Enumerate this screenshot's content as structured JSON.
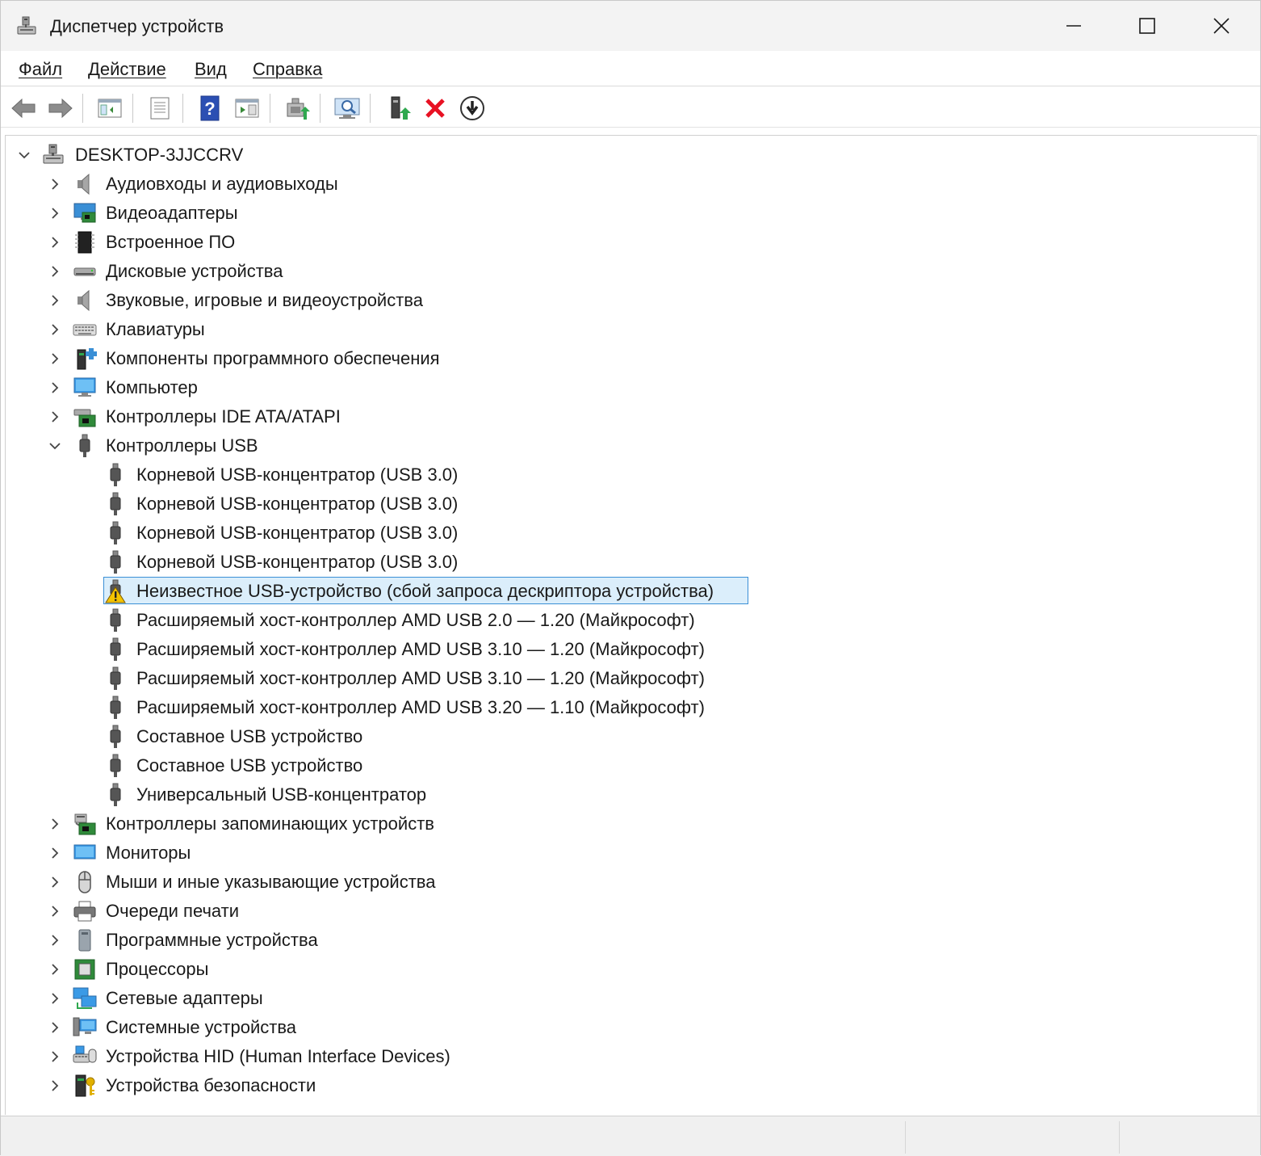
{
  "window": {
    "title": "Диспетчер устройств"
  },
  "menu": {
    "items": [
      {
        "label": "Файл"
      },
      {
        "label": "Действие"
      },
      {
        "label": "Вид"
      },
      {
        "label": "Справка"
      }
    ]
  },
  "toolbar": {
    "buttons": [
      {
        "icon": "back-arrow-icon"
      },
      {
        "icon": "forward-arrow-icon"
      },
      {
        "icon": "show-hide-console-tree-icon"
      },
      {
        "icon": "properties-icon"
      },
      {
        "icon": "help-icon"
      },
      {
        "icon": "action-pane-icon"
      },
      {
        "icon": "update-driver-icon"
      },
      {
        "icon": "scan-hardware-icon"
      },
      {
        "icon": "enable-device-icon"
      },
      {
        "icon": "uninstall-device-icon"
      },
      {
        "icon": "download-driver-icon"
      }
    ]
  },
  "tree": {
    "root": {
      "label": "DESKTOP-3JJCCRV",
      "expanded": true,
      "icon": "computer-network-icon"
    },
    "categories_before_usb": [
      {
        "label": "Аудиовходы и аудиовыходы",
        "icon": "speaker-icon"
      },
      {
        "label": "Видеоадаптеры",
        "icon": "display-adapter-icon"
      },
      {
        "label": "Встроенное ПО",
        "icon": "firmware-chip-icon"
      },
      {
        "label": "Дисковые устройства",
        "icon": "disk-drive-icon"
      },
      {
        "label": "Звуковые, игровые и видеоустройства",
        "icon": "speaker-icon"
      },
      {
        "label": "Клавиатуры",
        "icon": "keyboard-icon"
      },
      {
        "label": "Компоненты программного обеспечения",
        "icon": "software-component-icon"
      },
      {
        "label": "Компьютер",
        "icon": "computer-monitor-icon"
      },
      {
        "label": "Контроллеры IDE ATA/ATAPI",
        "icon": "ide-controller-icon"
      }
    ],
    "usb": {
      "label": "Контроллеры USB",
      "expanded": true,
      "icon": "usb-plug-icon",
      "children": [
        {
          "label": "Корневой USB-концентратор (USB 3.0)",
          "warning": false
        },
        {
          "label": "Корневой USB-концентратор (USB 3.0)",
          "warning": false
        },
        {
          "label": "Корневой USB-концентратор (USB 3.0)",
          "warning": false
        },
        {
          "label": "Корневой USB-концентратор (USB 3.0)",
          "warning": false
        },
        {
          "label": "Неизвестное USB-устройство (сбой запроса дескриптора устройства)",
          "warning": true,
          "selected": true
        },
        {
          "label": "Расширяемый хост-контроллер AMD USB 2.0 — 1.20 (Майкрософт)",
          "warning": false
        },
        {
          "label": "Расширяемый хост-контроллер AMD USB 3.10 — 1.20 (Майкрософт)",
          "warning": false
        },
        {
          "label": "Расширяемый хост-контроллер AMD USB 3.10 — 1.20 (Майкрософт)",
          "warning": false
        },
        {
          "label": "Расширяемый хост-контроллер AMD USB 3.20 — 1.10 (Майкрософт)",
          "warning": false
        },
        {
          "label": "Составное USB устройство",
          "warning": false
        },
        {
          "label": "Составное USB устройство",
          "warning": false
        },
        {
          "label": "Универсальный USB-концентратор",
          "warning": false
        }
      ]
    },
    "categories_after_usb": [
      {
        "label": "Контроллеры запоминающих устройств",
        "icon": "storage-controller-icon"
      },
      {
        "label": "Мониторы",
        "icon": "monitor-icon"
      },
      {
        "label": "Мыши и иные указывающие устройства",
        "icon": "mouse-icon"
      },
      {
        "label": "Очереди печати",
        "icon": "printer-icon"
      },
      {
        "label": "Программные устройства",
        "icon": "software-device-icon"
      },
      {
        "label": "Процессоры",
        "icon": "processor-icon"
      },
      {
        "label": "Сетевые адаптеры",
        "icon": "network-adapter-icon"
      },
      {
        "label": "Системные устройства",
        "icon": "system-device-icon"
      },
      {
        "label": "Устройства HID (Human Interface Devices)",
        "icon": "hid-device-icon"
      },
      {
        "label": "Устройства безопасности",
        "icon": "security-device-icon"
      }
    ]
  },
  "colors": {
    "selection_fill": "#dbeefb",
    "selection_border": "#3b8fd6",
    "warning": "#f5c400",
    "delete_red": "#e81123",
    "help_blue": "#2b4fb3"
  }
}
